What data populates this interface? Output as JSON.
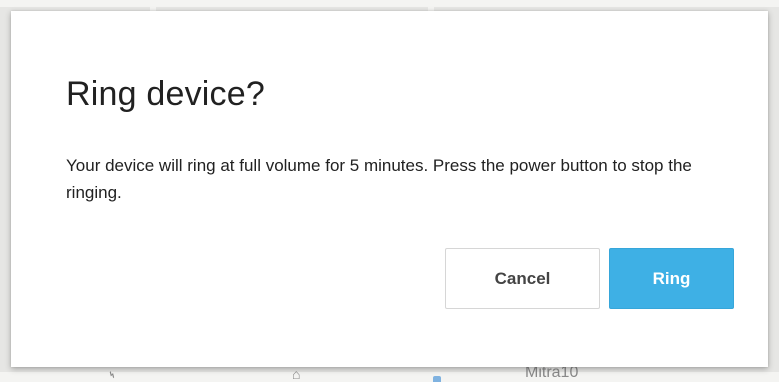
{
  "dialog": {
    "title": "Ring device?",
    "message": "Your device will ring at full volume for 5 minutes. Press the power button to stop the ringing.",
    "cancel_label": "Cancel",
    "ring_label": "Ring"
  },
  "map": {
    "place_label": "Mitra10"
  },
  "colors": {
    "primary": "#3eb0e5",
    "text": "#212121",
    "background_map": "#e6e6e4"
  }
}
